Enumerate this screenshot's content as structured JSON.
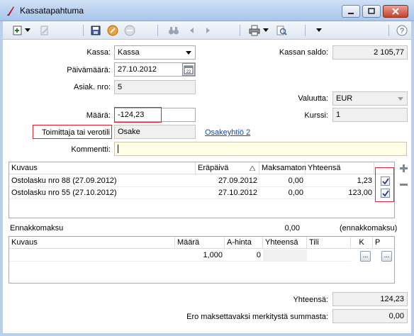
{
  "window": {
    "title": "Kassatapahtuma",
    "controls": {
      "minimize": "minimize-icon",
      "maximize": "maximize-icon",
      "close": "close-icon"
    }
  },
  "toolbar": {
    "icons": [
      "new-record-icon",
      "dropdown-icon",
      "edit-icon",
      "save-icon",
      "cancel-icon",
      "delete-icon",
      "binoculars-icon",
      "previous-icon",
      "next-icon",
      "print-icon",
      "dropdown-icon",
      "print-preview-icon",
      "more-icon",
      "help-icon"
    ]
  },
  "form": {
    "kassa_label": "Kassa:",
    "kassa_value": "Kassa",
    "saldo_label": "Kassan saldo:",
    "saldo_value": "2 105,77",
    "paivamaara_label": "Päivämäärä:",
    "paivamaara_value": "27.10.2012",
    "asiak_label": "Asiak. nro:",
    "asiak_value": "5",
    "valuutta_label": "Valuutta:",
    "valuutta_value": "EUR",
    "maara_label": "Määrä:",
    "maara_value": "-124,23",
    "kurssi_label": "Kurssi:",
    "kurssi_value": "1",
    "toimittaja_label": "Toimittaja tai verotili",
    "toimittaja_value": "Osake",
    "toimittaja_link": "Osakeyhtiö 2",
    "kommentti_label": "Kommentti:",
    "kommentti_value": ""
  },
  "invoices": {
    "columns": [
      "Kuvaus",
      "Eräpäivä",
      "Maksamaton",
      "Yhteensä"
    ],
    "rows": [
      {
        "kuvaus": "Ostolasku nro 88 (27.09.2012)",
        "erapaiva": "27.09.2012",
        "maksamaton": "0,00",
        "yhteensa": "1,23",
        "checked": true
      },
      {
        "kuvaus": "Ostolasku nro 55 (27.10.2012)",
        "erapaiva": "27.10.2012",
        "maksamaton": "0,00",
        "yhteensa": "123,00",
        "checked": true
      }
    ],
    "add_icon": "plus-icon",
    "remove_icon": "minus-icon"
  },
  "ennakko": {
    "label": "Ennakkomaksu",
    "value": "0,00",
    "note": "(ennakkomaksu)"
  },
  "rows_grid": {
    "columns": [
      "Kuvaus",
      "Määrä",
      "A-hinta",
      "Yhteensä",
      "Tili",
      "K",
      "P"
    ],
    "rows": [
      {
        "kuvaus": "",
        "maara": "1,000",
        "ahinta": "0",
        "yhteensa": "",
        "tili": "",
        "k": "...",
        "p": "..."
      }
    ]
  },
  "totals": {
    "yhteensa_label": "Yhteensä:",
    "yhteensa_value": "124,23",
    "ero_label": "Ero maksettavaksi merkitystä summasta:",
    "ero_value": "0,00"
  }
}
